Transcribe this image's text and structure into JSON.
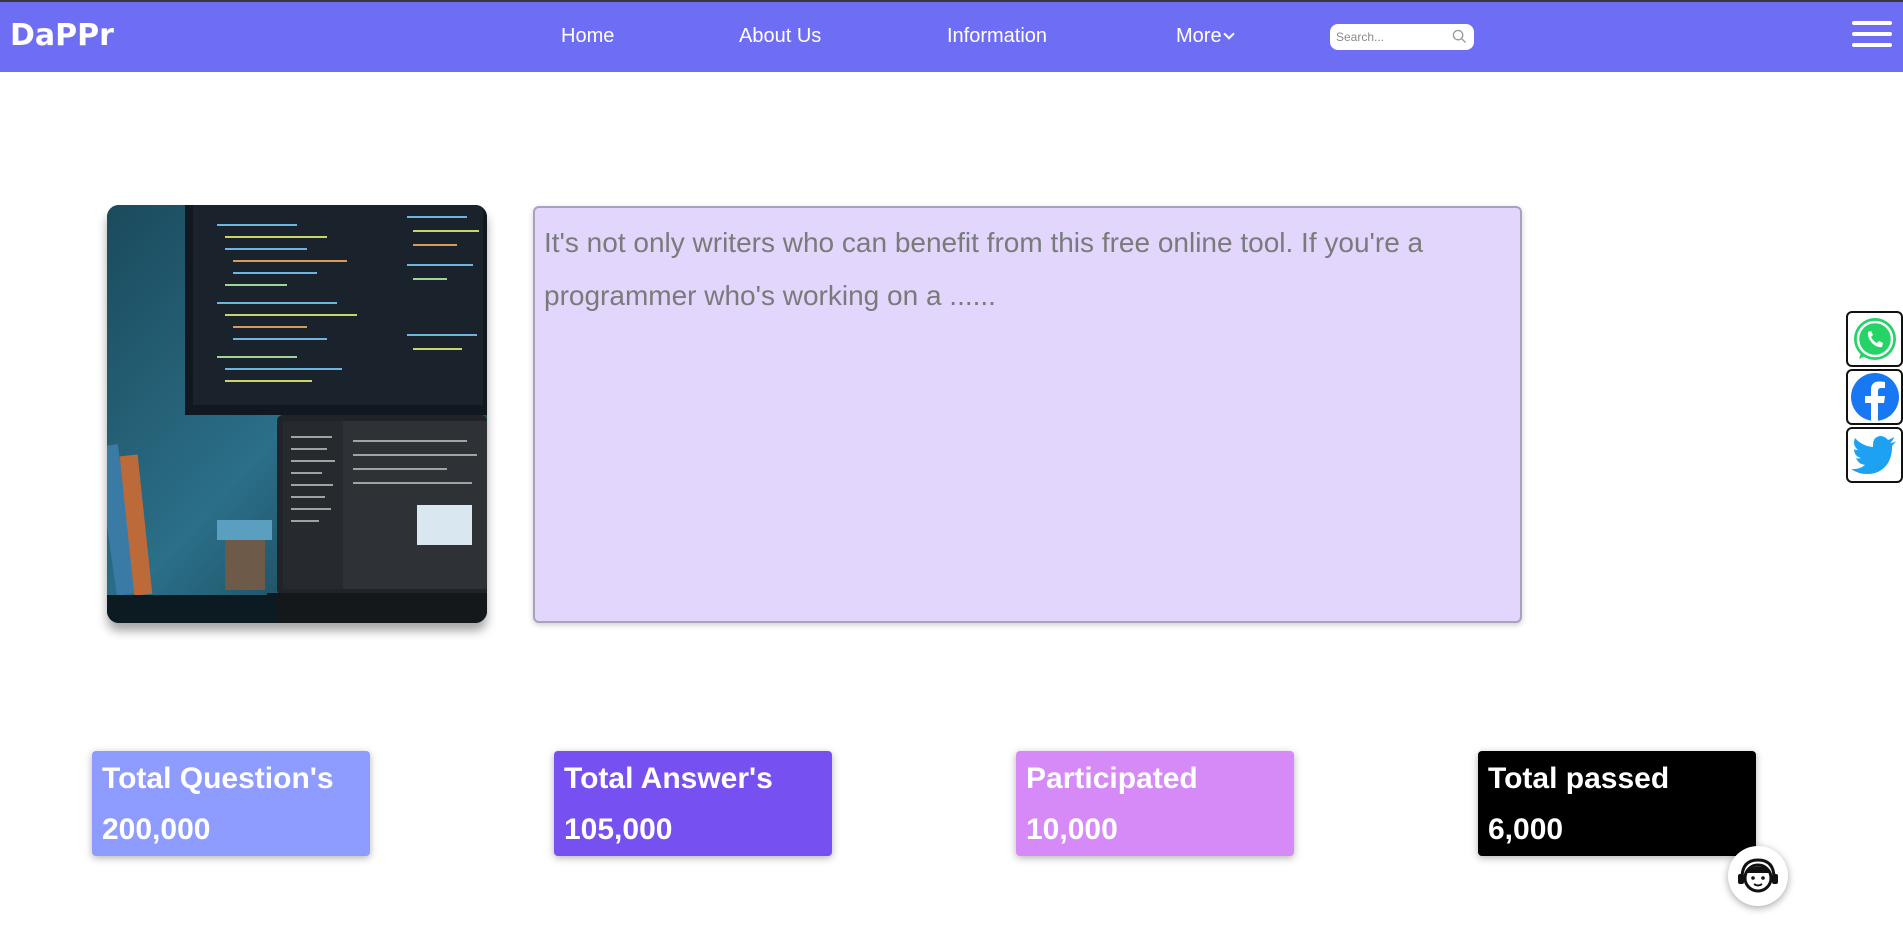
{
  "brand": {
    "logo": "DaPPr"
  },
  "nav": {
    "home": "Home",
    "about": "About Us",
    "information": "Information",
    "more": "More"
  },
  "search": {
    "placeholder": "Search..."
  },
  "hero": {
    "text": "It's not only writers who can benefit from this free online tool. If you're a programmer who's working on a ......"
  },
  "share": [
    {
      "name": "whatsapp-icon",
      "color": "#25d366"
    },
    {
      "name": "facebook-icon",
      "color": "#1877f2"
    },
    {
      "name": "twitter-icon",
      "color": "#1da1f2"
    }
  ],
  "stats": [
    {
      "label": "Total Question's",
      "value": "200,000",
      "color": "#8f9cff"
    },
    {
      "label": "Total Answer's",
      "value": "105,000",
      "color": "#7650f0"
    },
    {
      "label": "Participated",
      "value": "10,000",
      "color": "#d58af8"
    },
    {
      "label": "Total passed",
      "value": "6,000",
      "color": "#000000"
    }
  ],
  "colors": {
    "nav": "#6e6ef5",
    "info_bg": "#e2d6fc"
  }
}
